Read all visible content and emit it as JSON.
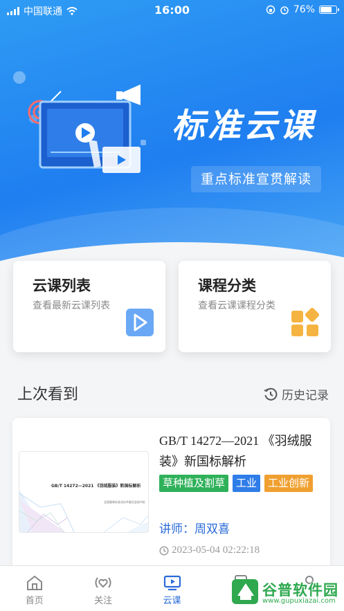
{
  "status_bar": {
    "carrier": "中国联通",
    "time": "16:00",
    "battery": "76%",
    "battery_level": 0.76
  },
  "banner": {
    "title": "标准云课",
    "subtitle": "重点标准宣贯解读"
  },
  "quick_cards": [
    {
      "title": "云课列表",
      "desc": "查看最新云课列表",
      "icon": "play-icon",
      "color": "#6aa8f5"
    },
    {
      "title": "课程分类",
      "desc": "查看云课课程分类",
      "icon": "category-icon",
      "color": "#f5b441"
    }
  ],
  "last_watched": {
    "title": "上次看到",
    "history_label": "历史记录"
  },
  "course": {
    "title": "GB/T 14272—2021 《羽绒服装》新国标解析",
    "thumb_title": "GB/T 14272—2021 《羽绒服装》新国标解析",
    "thumb_sub": "全国服装标准化技术委员会秘书处",
    "tags": [
      {
        "label": "草种植及割草",
        "color": "#2fb15a"
      },
      {
        "label": "工业",
        "color": "#2f7de8"
      },
      {
        "label": "工业创新",
        "color": "#f0a030"
      }
    ],
    "lecturer": "讲师：周双喜",
    "date": "2023-05-04 02:22:18"
  },
  "tabbar": [
    {
      "label": "首页",
      "icon": "home-icon",
      "active": false
    },
    {
      "label": "关注",
      "icon": "follow-icon",
      "active": false
    },
    {
      "label": "云课",
      "icon": "cloud-course-icon",
      "active": true
    },
    {
      "label": "文",
      "icon": "doc-icon",
      "active": false
    },
    {
      "label": "",
      "icon": "user-icon",
      "active": false
    }
  ],
  "watermark": {
    "text": "谷普软件园",
    "url": "www.gupuxiazai.com"
  }
}
